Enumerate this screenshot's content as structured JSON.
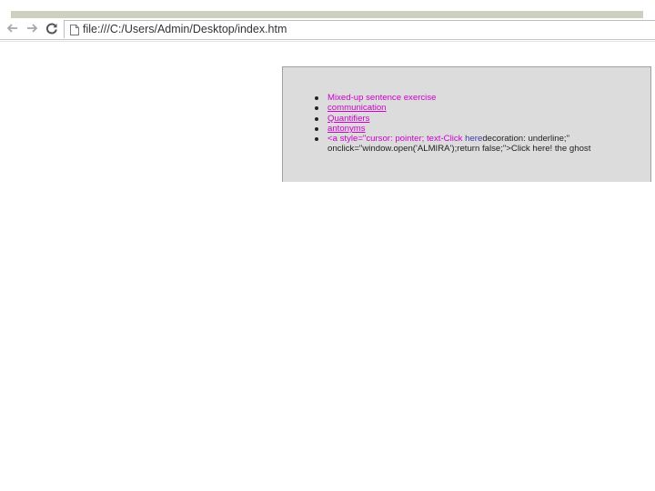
{
  "browser": {
    "back_icon": "back-arrow-icon",
    "forward_icon": "forward-arrow-icon",
    "reload_icon": "reload-icon",
    "page_icon": "page-icon",
    "url": "file:///C:/Users/Admin/Desktop/index.htm"
  },
  "page": {
    "links": [
      {
        "label": "Mixed-up sentence exercise"
      },
      {
        "label": "communication"
      },
      {
        "label": "Quantifiers"
      },
      {
        "label": "antonyms"
      }
    ],
    "raw_item": {
      "part1": "<a style=\"cursor: pointer; text-Click ",
      "part2": "here",
      "part3": "decoration: underline;\"",
      "line2": "onclick=\"window.open('ALMIRA');return false;\">Click here! the ghost"
    }
  },
  "colors": {
    "link": "#cc00cc",
    "content_bg": "#dcdcdc",
    "strip": "#cfcfc0"
  }
}
